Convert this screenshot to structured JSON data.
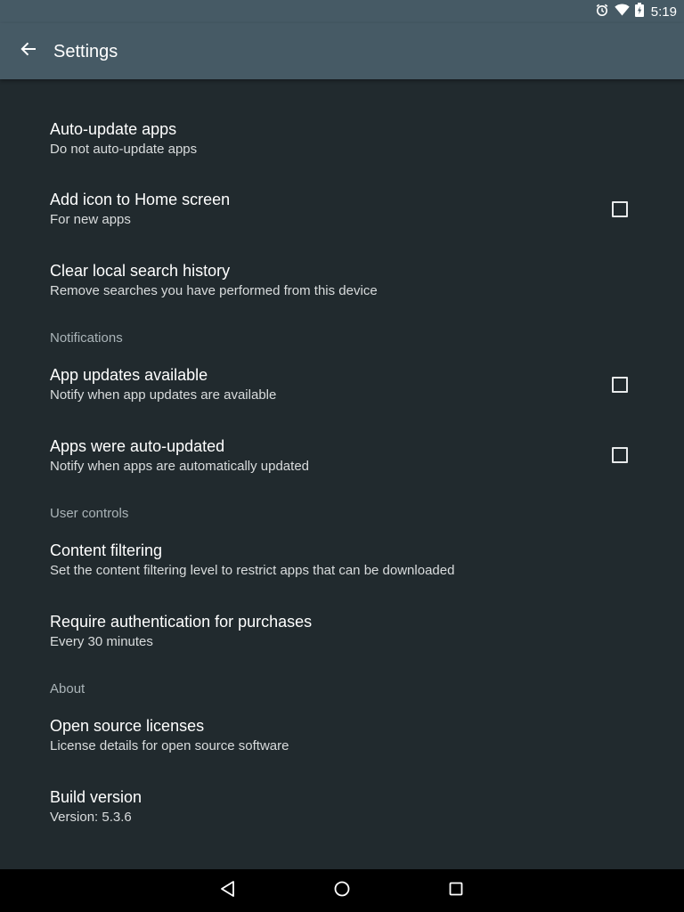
{
  "status_bar": {
    "time": "5:19",
    "icons": [
      "alarm-icon",
      "wifi-icon",
      "battery-icon"
    ]
  },
  "app_bar": {
    "title": "Settings",
    "back_icon": "arrow-back-icon"
  },
  "general": {
    "auto_update": {
      "title": "Auto-update apps",
      "summary": "Do not auto-update apps"
    },
    "add_icon": {
      "title": "Add icon to Home screen",
      "summary": "For new apps",
      "checked": false
    },
    "clear_history": {
      "title": "Clear local search history",
      "summary": "Remove searches you have performed from this device"
    }
  },
  "notifications": {
    "header": "Notifications",
    "updates_available": {
      "title": "App updates available",
      "summary": "Notify when app updates are available",
      "checked": false
    },
    "auto_updated": {
      "title": "Apps were auto-updated",
      "summary": "Notify when apps are automatically updated",
      "checked": false
    }
  },
  "user_controls": {
    "header": "User controls",
    "content_filtering": {
      "title": "Content filtering",
      "summary": "Set the content filtering level to restrict apps that can be downloaded"
    },
    "require_auth": {
      "title": "Require authentication for purchases",
      "summary": "Every 30 minutes"
    }
  },
  "about": {
    "header": "About",
    "licenses": {
      "title": "Open source licenses",
      "summary": "License details for open source software"
    },
    "build_version": {
      "title": "Build version",
      "summary": "Version: 5.3.6"
    }
  },
  "nav_bar": {
    "icons": [
      "nav-back-icon",
      "nav-home-icon",
      "nav-recents-icon"
    ]
  },
  "colors": {
    "toolbar": "#465a65",
    "background": "#212a2e",
    "section_header": "#aab4b8",
    "nav_bar": "#000000"
  }
}
